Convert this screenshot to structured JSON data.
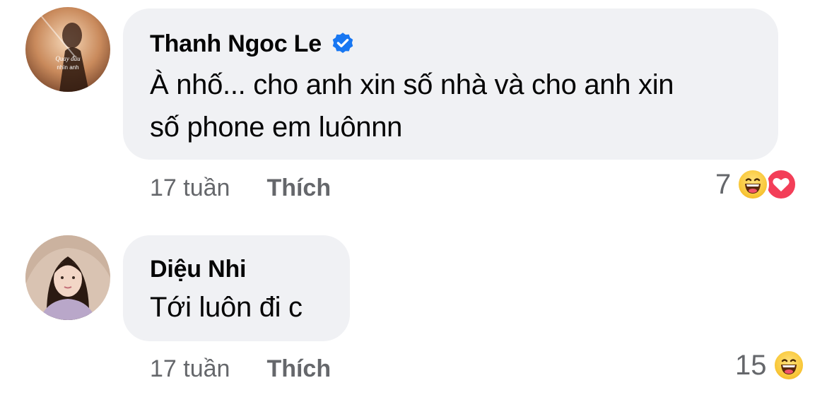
{
  "comments": [
    {
      "author": "Thanh Ngoc Le",
      "verified": true,
      "avatar_icon": "album-cover-avatar",
      "text_lines": [
        "À nhố... cho anh xin số nhà và cho anh xin",
        "số phone em luônnn"
      ],
      "time": "17 tuần",
      "like_label": "Thích",
      "reaction_count": "7",
      "reactions": [
        "haha-icon",
        "love-icon"
      ]
    },
    {
      "author": "Diệu Nhi",
      "verified": false,
      "avatar_icon": "profile-photo-avatar",
      "text_lines": [
        "Tới luôn đi c"
      ],
      "time": "17 tuần",
      "like_label": "Thích",
      "reaction_count": "15",
      "reactions": [
        "haha-icon"
      ]
    }
  ],
  "colors": {
    "bubble": "#f0f1f4",
    "meta_text": "#65676b",
    "verified_badge": "#1877f2",
    "love": "#f33e58",
    "haha": "#f9c93c"
  }
}
